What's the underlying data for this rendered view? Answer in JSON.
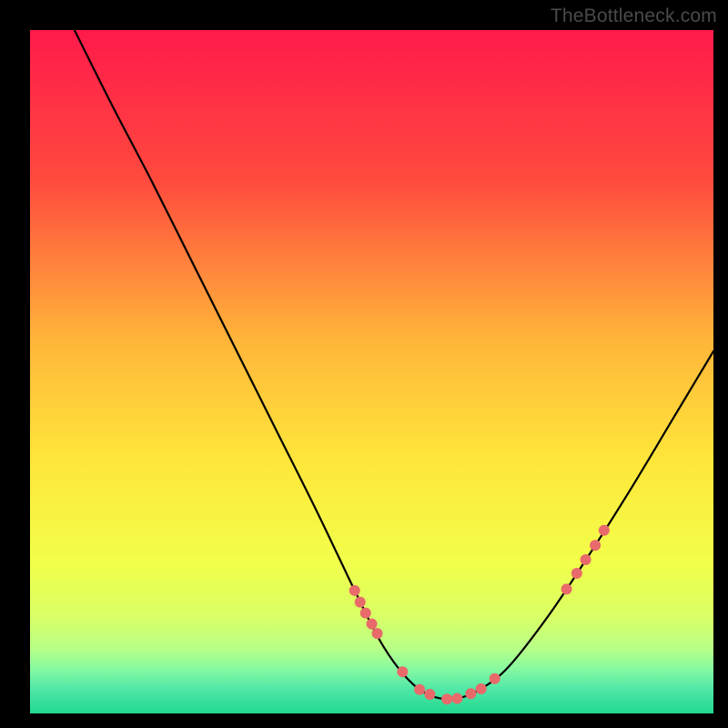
{
  "attribution": "TheBottleneck.com",
  "chart_data": {
    "type": "line",
    "title": "",
    "xlabel": "",
    "ylabel": "",
    "xlim": [
      0,
      100
    ],
    "ylim": [
      0,
      100
    ],
    "gradient_stops": [
      {
        "offset": 0.0,
        "color": "#ff1a4b"
      },
      {
        "offset": 0.22,
        "color": "#ff4a3e"
      },
      {
        "offset": 0.45,
        "color": "#ffb43a"
      },
      {
        "offset": 0.63,
        "color": "#ffe63a"
      },
      {
        "offset": 0.78,
        "color": "#f1ff4a"
      },
      {
        "offset": 0.86,
        "color": "#d8ff66"
      },
      {
        "offset": 0.905,
        "color": "#b8ff87"
      },
      {
        "offset": 0.935,
        "color": "#86f9a0"
      },
      {
        "offset": 0.965,
        "color": "#4fe7a7"
      },
      {
        "offset": 1.0,
        "color": "#22d88f"
      }
    ],
    "series": [
      {
        "name": "bottleneck-curve",
        "x": [
          6.5,
          12,
          18,
          24,
          30,
          36,
          42,
          47.5,
          51,
          54,
          57,
          60,
          63,
          66,
          70,
          76,
          82,
          88,
          94,
          100
        ],
        "y": [
          100,
          89,
          77.5,
          65.5,
          53.5,
          41.5,
          29.5,
          18,
          11,
          6.5,
          3.5,
          2.2,
          2.3,
          3.6,
          6.8,
          14.5,
          23.5,
          33,
          43,
          53
        ]
      }
    ],
    "markers": {
      "name": "highlighted-points",
      "x": [
        47.5,
        48.3,
        49.1,
        50,
        50.8,
        54.5,
        57,
        58.5,
        61,
        62.5,
        64.5,
        66,
        68,
        78.5,
        80,
        81.3,
        82.7,
        84
      ],
      "y": [
        18,
        16.3,
        14.7,
        13.1,
        11.7,
        6.1,
        3.5,
        2.8,
        2.1,
        2.2,
        2.9,
        3.6,
        5.1,
        18.2,
        20.5,
        22.5,
        24.6,
        26.8
      ],
      "color": "#e86a6a",
      "radius": 6
    }
  }
}
